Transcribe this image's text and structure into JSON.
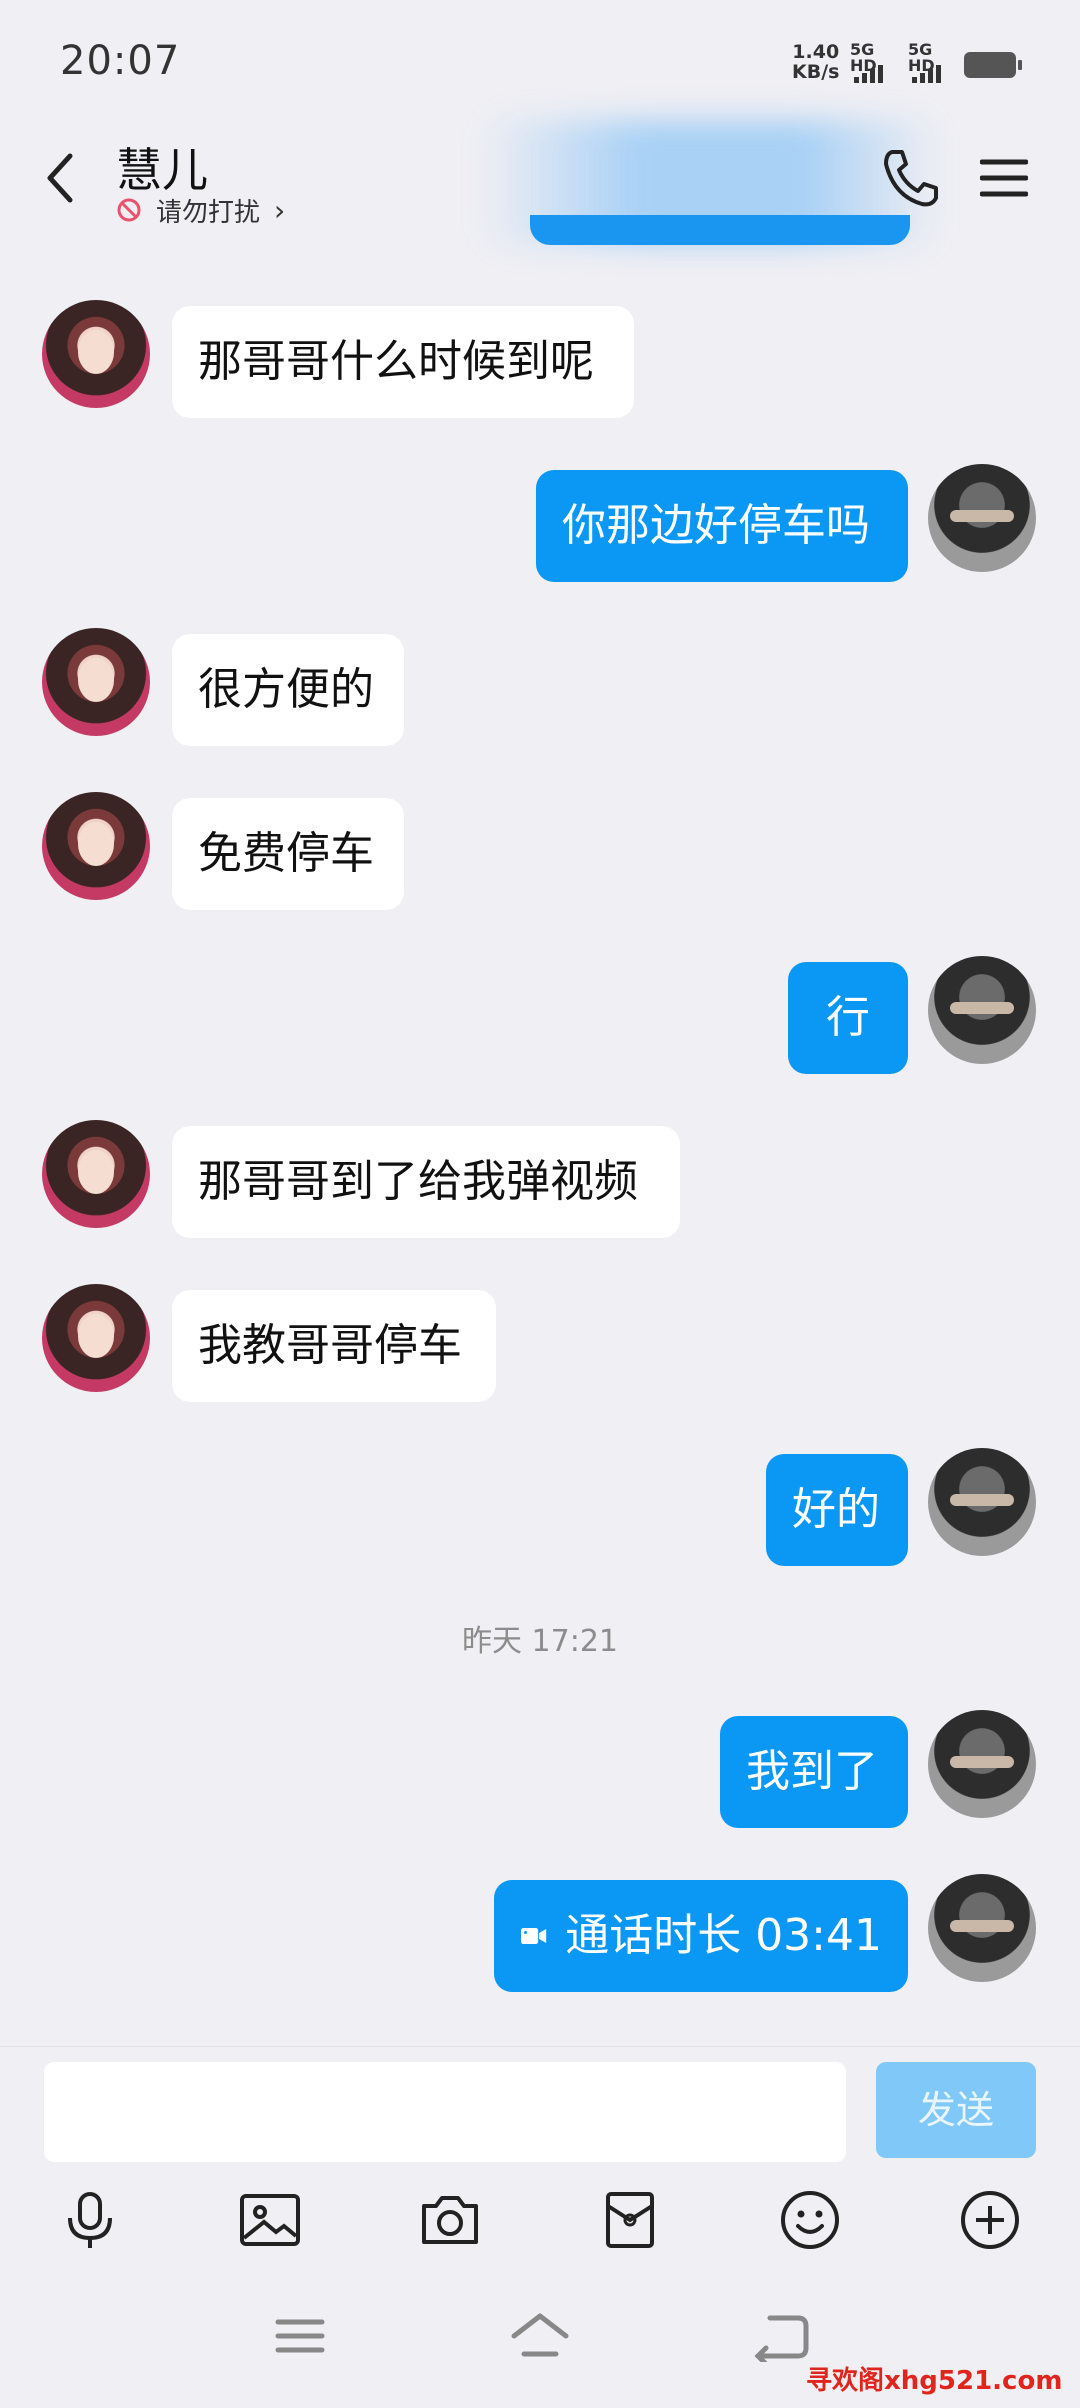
{
  "status": {
    "time": "20:07",
    "net_speed_value": "1.40",
    "net_speed_unit": "KB/s",
    "sim1": "5G HD",
    "sim2": "5G HD"
  },
  "header": {
    "contact_name": "慧儿",
    "dnd_text": "请勿打扰",
    "dnd_chevron": "›"
  },
  "messages": [
    {
      "side": "in",
      "text": "那哥哥什么时候到呢"
    },
    {
      "side": "out",
      "text": "你那边好停车吗"
    },
    {
      "side": "in",
      "text": "很方便的"
    },
    {
      "side": "in",
      "text": "免费停车"
    },
    {
      "side": "out",
      "text": "行"
    },
    {
      "side": "in",
      "text": "那哥哥到了给我弹视频"
    },
    {
      "side": "in",
      "text": "我教哥哥停车"
    },
    {
      "side": "out",
      "text": "好的"
    },
    {
      "side": "out",
      "text": "我到了"
    },
    {
      "side": "out",
      "text": "通话时长 03:41"
    }
  ],
  "timestamp": "昨天 17:21",
  "composer": {
    "input_value": "",
    "send_label": "发送"
  },
  "toolbar_icons": [
    "microphone-icon",
    "image-icon",
    "camera-icon",
    "red-packet-icon",
    "emoji-icon",
    "plus-icon"
  ],
  "nav_icons": [
    "menu-nav-icon",
    "home-nav-icon",
    "back-nav-icon"
  ],
  "watermark": "寻欢阁xhg521.com",
  "colors": {
    "accent": "#0b97f4",
    "send_disabled": "#7fc8f8",
    "background": "#efeff4"
  }
}
